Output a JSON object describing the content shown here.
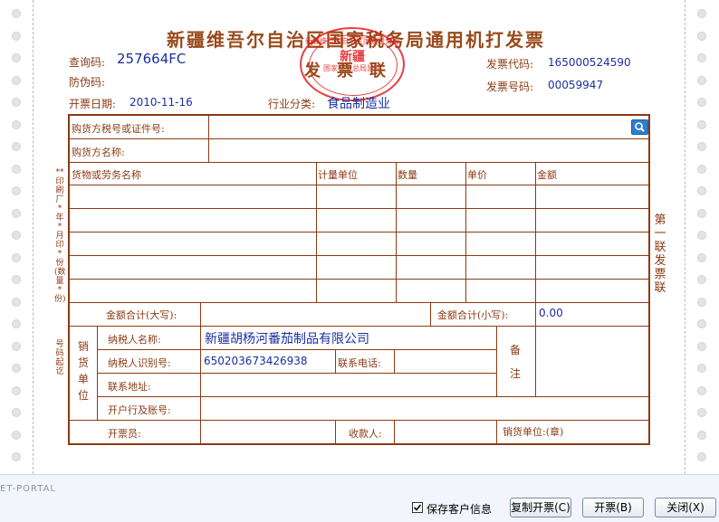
{
  "invoice": {
    "title": "新疆维吾尔自治区国家税务局通用机打发票",
    "subtitle": "发票联",
    "stamp": {
      "ring": "新疆维吾尔自治区国家税务局",
      "center": "新疆",
      "bottom": "国家税务总局监制"
    },
    "query_code_label": "查询码:",
    "query_code": "257664FC",
    "anti_fake_label": "防伪码:",
    "anti_fake": "",
    "issue_date_label": "开票日期:",
    "issue_date": "2010-11-16",
    "industry_label": "行业分类:",
    "industry": "食品制造业",
    "invoice_code_label": "发票代码:",
    "invoice_code": "165000524590",
    "invoice_number_label": "发票号码:",
    "invoice_number": "00059947"
  },
  "form": {
    "buyer_tax_label": "购货方税号或证件号:",
    "buyer_tax_value": "",
    "buyer_name_label": "购货方名称:",
    "buyer_name_value": "",
    "columns": {
      "item": "货物或劳务名称",
      "unit": "计量单位",
      "qty": "数量",
      "price": "单价",
      "amount": "金额"
    },
    "total_upper_label": "金额合计(大写):",
    "total_upper": "",
    "total_lower_label": "金额合计(小写):",
    "total_lower": "0.00",
    "seller_section": "销货单位",
    "seller_name_label": "纳税人名称:",
    "seller_name": "新疆胡杨河番茄制品有限公司",
    "seller_tax_label": "纳税人识别号:",
    "seller_tax": "650203673426938",
    "phone_label": "联系电话:",
    "phone": "",
    "address_label": "联系地址:",
    "address": "",
    "bank_label": "开户行及账号:",
    "bank": "",
    "remark_label": "备注",
    "drawer_label": "开票员:",
    "payee_label": "收款人:",
    "seller_seal_label": "销货单位:(章)"
  },
  "margins": {
    "left_note": "**印刷厂*年*月印*份(数量*份)",
    "left_note2": "号码起讫",
    "right_note": "第一联发票联"
  },
  "footer": {
    "portal_label": "ET-PORTAL",
    "save_customer_label": "保存客户信息",
    "save_customer_checked": true,
    "copy_button": "复制开票(C)",
    "issue_button": "开票(B)",
    "close_button": "关闭(X)"
  },
  "colors": {
    "frame": "#8b3a14",
    "value_text": "#1a2fa0",
    "stamp": "#e02020"
  }
}
